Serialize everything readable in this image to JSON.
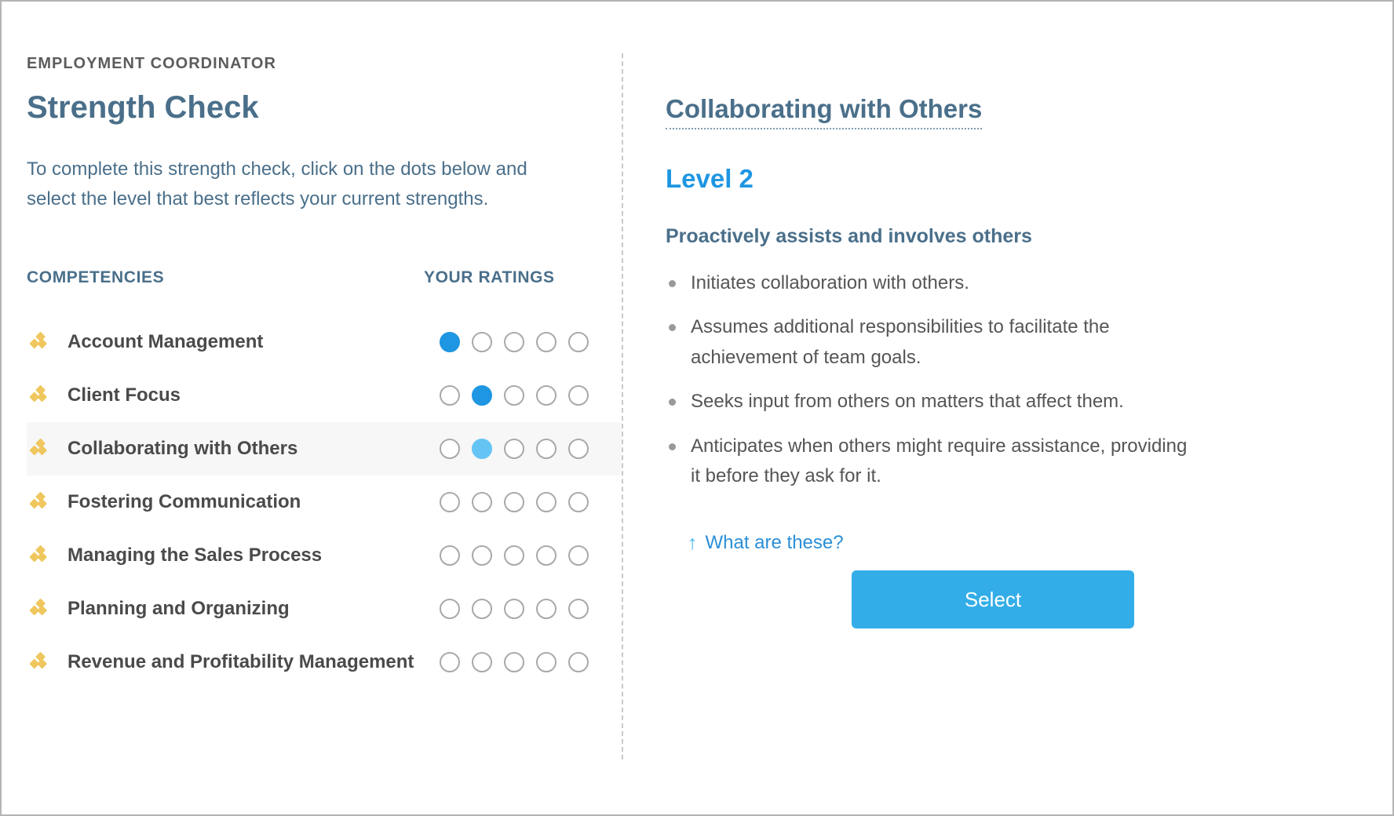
{
  "colors": {
    "accent_blue": "#1e96e2",
    "hover_blue": "#66c4f5",
    "button_blue": "#33ade8",
    "heading_steel": "#4a6f8a",
    "diamond_gold": "#efc75e",
    "row_highlight": "#f7f7f7",
    "dot_outline": "#a9a9a9"
  },
  "left": {
    "eyebrow": "EMPLOYMENT COORDINATOR",
    "title": "Strength Check",
    "intro": "To complete this strength check, click on the dots below and select the level that best reflects your current strengths.",
    "column_headers": {
      "competencies": "COMPETENCIES",
      "ratings": "YOUR RATINGS"
    },
    "rating_scale": 5,
    "rows": [
      {
        "label": "Account Management",
        "selected": 1,
        "hovered": 0,
        "active": false,
        "icon": "diamond-cluster-icon"
      },
      {
        "label": "Client Focus",
        "selected": 2,
        "hovered": 0,
        "active": false,
        "icon": "diamond-cluster-icon"
      },
      {
        "label": "Collaborating with Others",
        "selected": 0,
        "hovered": 2,
        "active": true,
        "icon": "diamond-cluster-icon"
      },
      {
        "label": "Fostering Communication",
        "selected": 0,
        "hovered": 0,
        "active": false,
        "icon": "diamond-cluster-icon"
      },
      {
        "label": "Managing the Sales Process",
        "selected": 0,
        "hovered": 0,
        "active": false,
        "icon": "diamond-cluster-icon"
      },
      {
        "label": "Planning and Organizing",
        "selected": 0,
        "hovered": 0,
        "active": false,
        "icon": "diamond-cluster-icon"
      },
      {
        "label": "Revenue and Profitability Management",
        "selected": 0,
        "hovered": 0,
        "active": false,
        "icon": "diamond-cluster-icon"
      }
    ]
  },
  "right": {
    "competency_title": "Collaborating with Others",
    "level": "Level 2",
    "level_summary": "Proactively assists and involves others",
    "bullets": [
      "Initiates collaboration with others.",
      "Assumes additional responsibilities to facilitate the achievement of team goals.",
      "Seeks input from others on matters that affect them.",
      "Anticipates when others might require assistance, providing it before they ask for it."
    ],
    "what_are_these": {
      "arrow": "↑",
      "label": "What are these?"
    },
    "select_button": "Select"
  }
}
